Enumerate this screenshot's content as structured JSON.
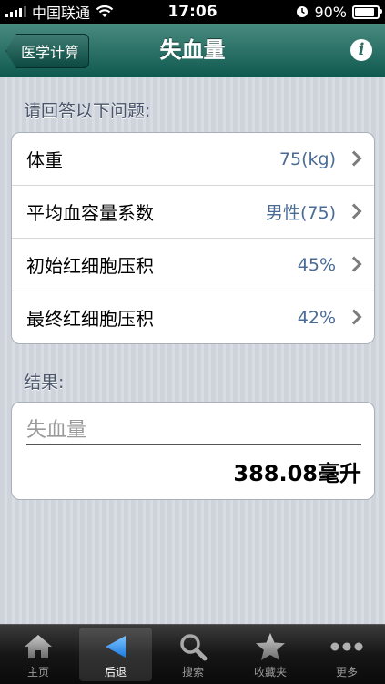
{
  "status_bar": {
    "carrier": "中国联通",
    "time": "17:06",
    "battery": "90%"
  },
  "nav": {
    "back_label": "医学计算",
    "title": "失血量",
    "info_icon": "info-icon"
  },
  "questions": {
    "header": "请回答以下问题:",
    "rows": [
      {
        "label": "体重",
        "value": "75(kg)"
      },
      {
        "label": "平均血容量系数",
        "value": "男性(75)"
      },
      {
        "label": "初始红细胞压积",
        "value": "45%"
      },
      {
        "label": "最终红细胞压积",
        "value": "42%"
      }
    ]
  },
  "result": {
    "header": "结果:",
    "name": "失血量",
    "value": "388.08毫升"
  },
  "tabs": [
    {
      "label": "主页",
      "icon": "home-icon"
    },
    {
      "label": "后退",
      "icon": "back-arrow-icon"
    },
    {
      "label": "搜索",
      "icon": "search-icon"
    },
    {
      "label": "收藏夹",
      "icon": "star-icon"
    },
    {
      "label": "更多",
      "icon": "more-icon"
    }
  ],
  "colors": {
    "nav_bar": "#1f6b61",
    "value_text": "#4a6b96"
  }
}
